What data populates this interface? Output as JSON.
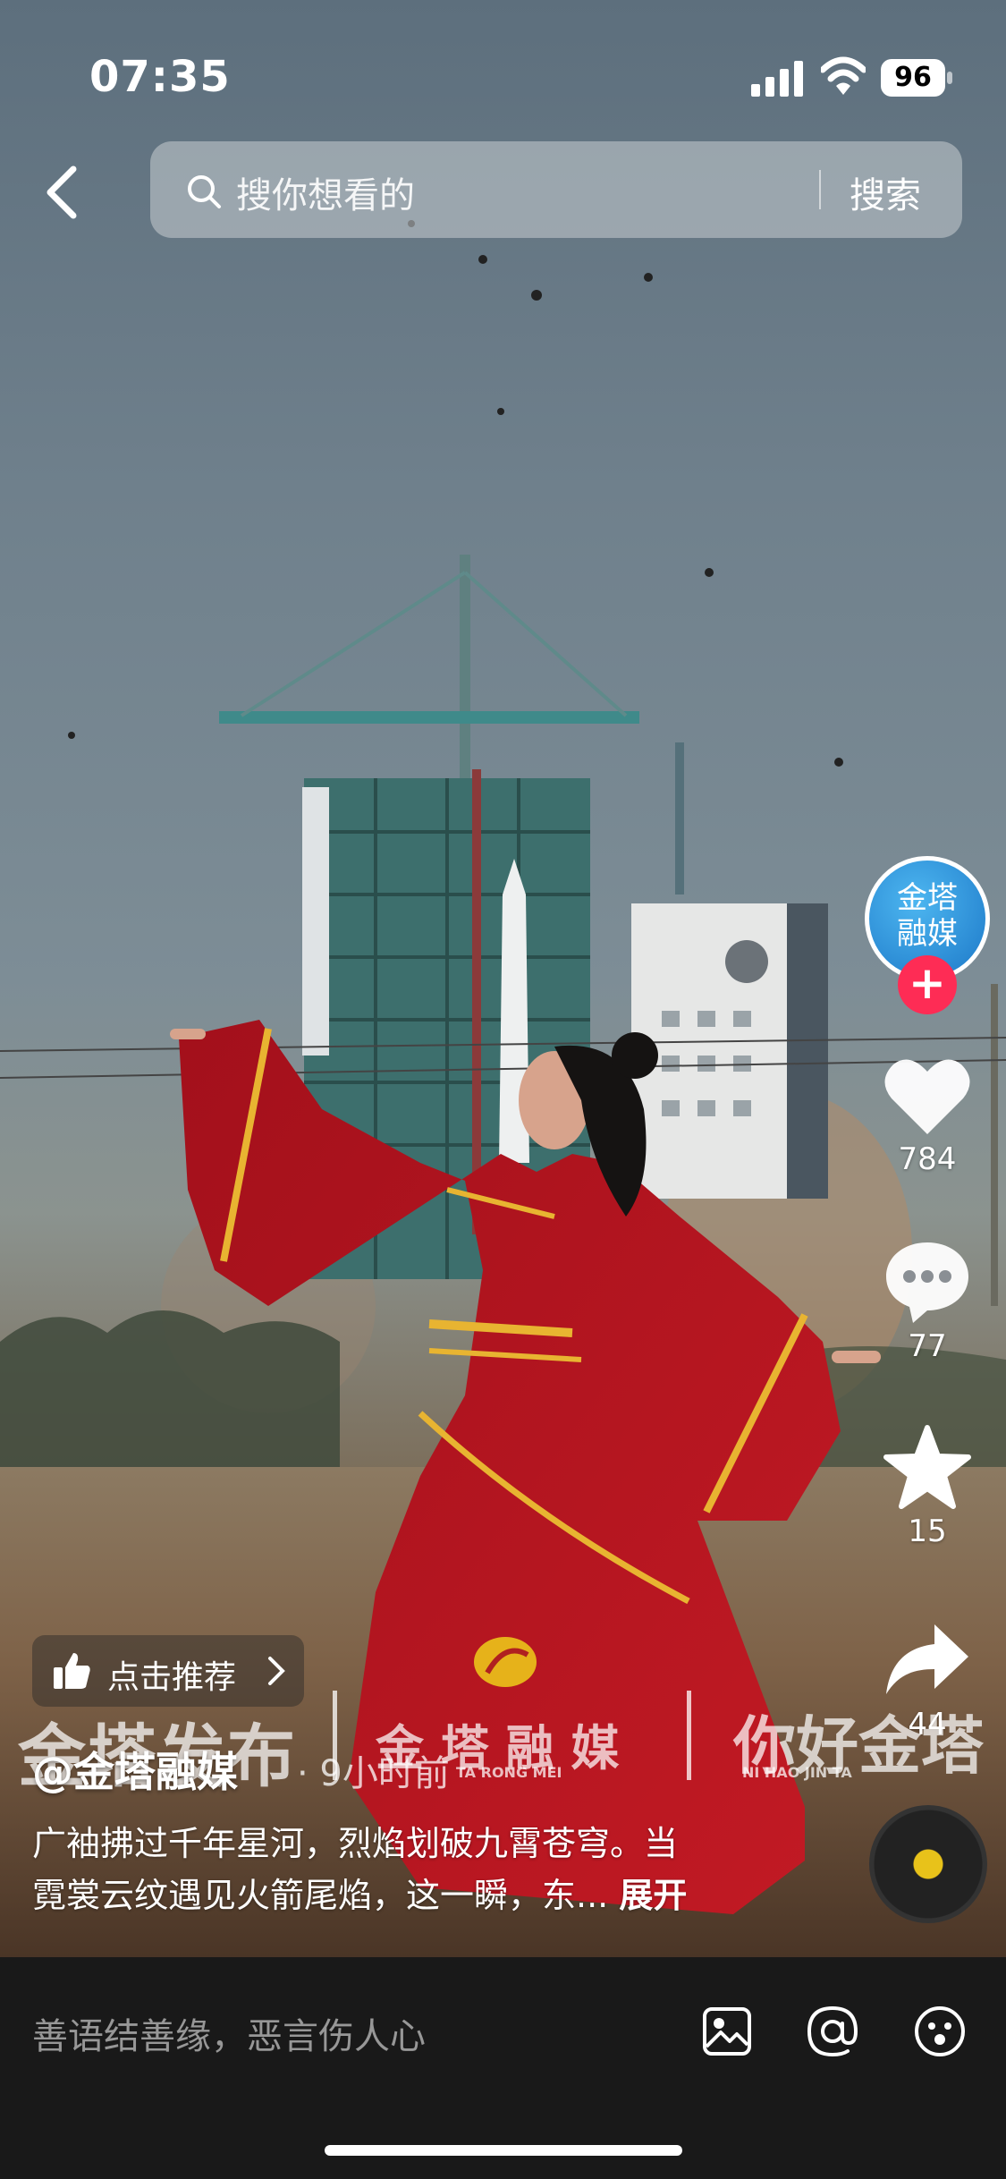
{
  "status_bar": {
    "time": "07:35",
    "battery": "96"
  },
  "search": {
    "placeholder": "搜你想看的",
    "button": "搜索"
  },
  "author": {
    "avatar_text_1": "金塔",
    "avatar_text_2": "融媒",
    "follow": "+",
    "name": "@金塔融媒",
    "posted": "· 9小时前"
  },
  "actions": {
    "likes": "784",
    "comments": "77",
    "favorites": "15",
    "shares": "44"
  },
  "watermark": {
    "left": "金塔发布",
    "middle": "金 塔 融 媒",
    "middle_pinyin": "TA  RONG  MEI",
    "right": "你好金塔",
    "right_pinyin": "NI   HAO   JIN   TA"
  },
  "recommend": {
    "label": "点击推荐"
  },
  "caption": {
    "line1": "广袖拂过千年星河，烈焰划破九霄苍穹。当",
    "line2": "霓裳云纹遇见火箭尾焰，这一瞬，东...",
    "expand": "展开"
  },
  "comment_bar": {
    "placeholder": "善语结善缘，恶言伤人心"
  },
  "colors": {
    "accent_red": "#fe2c55",
    "background": "#191919"
  },
  "icons": [
    "back-arrow-icon",
    "search-icon",
    "heart-icon",
    "comment-icon",
    "star-icon",
    "share-icon",
    "thumb-up-icon",
    "image-icon",
    "at-icon",
    "emoji-icon"
  ]
}
